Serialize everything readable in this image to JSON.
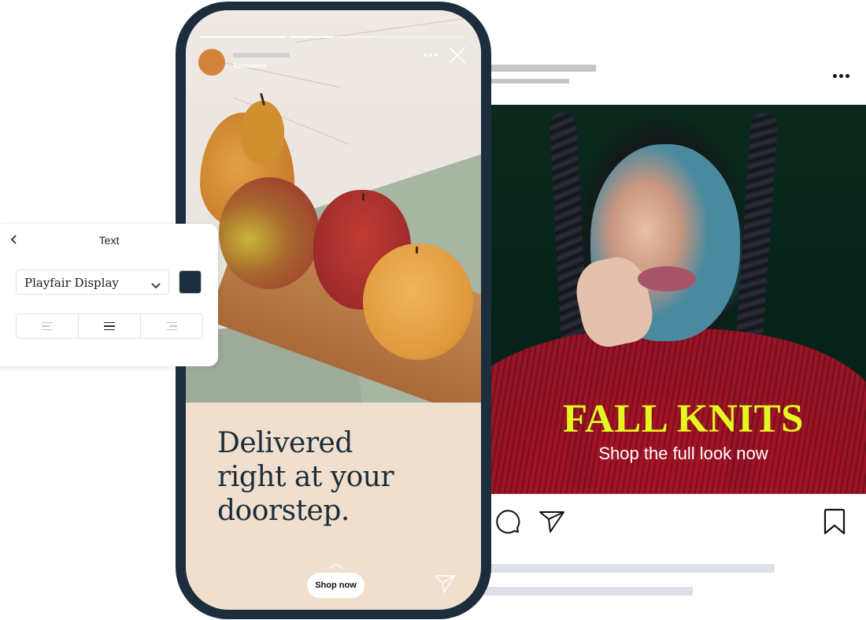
{
  "feed_post": {
    "headline": "FALL KNITS",
    "subheadline": "Shop the full look now",
    "headline_color": "#e4f720",
    "more_icon": "more-horizontal-icon",
    "actions": [
      {
        "name": "comment",
        "icon": "comment-bubble-icon"
      },
      {
        "name": "share",
        "icon": "paper-plane-icon"
      },
      {
        "name": "save",
        "icon": "bookmark-icon"
      }
    ]
  },
  "story": {
    "sponsored_label": "Sponsored",
    "avatar_color": "#d4843a",
    "progress": [
      1.0,
      0.5,
      0.0
    ],
    "headline_lines": [
      "Delivered",
      "right at your",
      "doorstep."
    ],
    "cta_label": "Shop now",
    "background_color": "#efdfcc",
    "text_color": "#1c2e3d",
    "icons": {
      "more": "more-horizontal-icon",
      "close": "close-icon",
      "swipe_up": "chevron-up-icon",
      "send": "paper-plane-icon"
    }
  },
  "text_panel": {
    "title": "Text",
    "back_icon": "chevron-left-icon",
    "font_select": {
      "selected": "Playfair Display",
      "icon": "chevron-down-icon"
    },
    "text_color": "#1c2f3f",
    "alignment": {
      "options": [
        "left",
        "center",
        "right"
      ],
      "selected": "center"
    }
  },
  "frame_color": "#1c2e3d"
}
